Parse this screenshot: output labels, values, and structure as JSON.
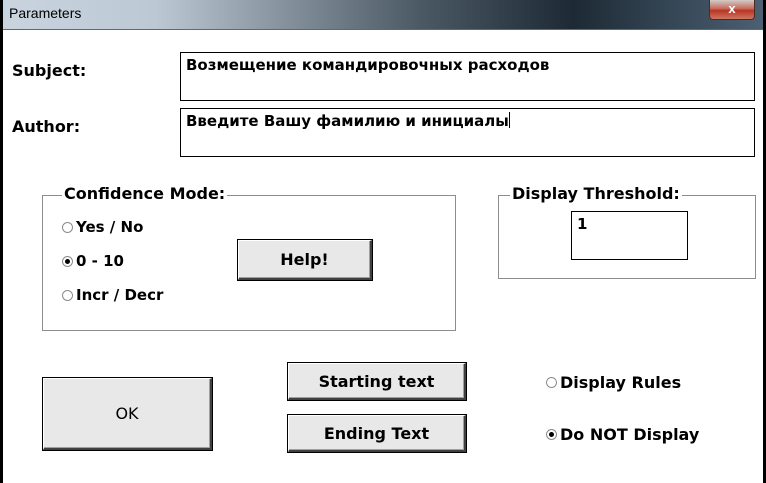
{
  "window": {
    "title": "Parameters",
    "close_glyph": "x"
  },
  "subject": {
    "label": "Subject:",
    "value": "Возмещение командировочных расходов"
  },
  "author": {
    "label": "Author:",
    "value": "Введите Вашу фамилию и инициалы"
  },
  "confidence_mode": {
    "title": "Confidence Mode:",
    "options": [
      {
        "label": "Yes / No",
        "selected": false
      },
      {
        "label": "0 - 10",
        "selected": true
      },
      {
        "label": "Incr / Decr",
        "selected": false
      }
    ],
    "help_label": "Help!"
  },
  "display_threshold": {
    "title": "Display Threshold:",
    "value": "1"
  },
  "buttons": {
    "ok": "OK",
    "starting_text": "Starting text",
    "ending_text": "Ending Text"
  },
  "display_rules": {
    "options": [
      {
        "label": "Display Rules",
        "selected": false
      },
      {
        "label": "Do NOT Display",
        "selected": true
      }
    ]
  }
}
